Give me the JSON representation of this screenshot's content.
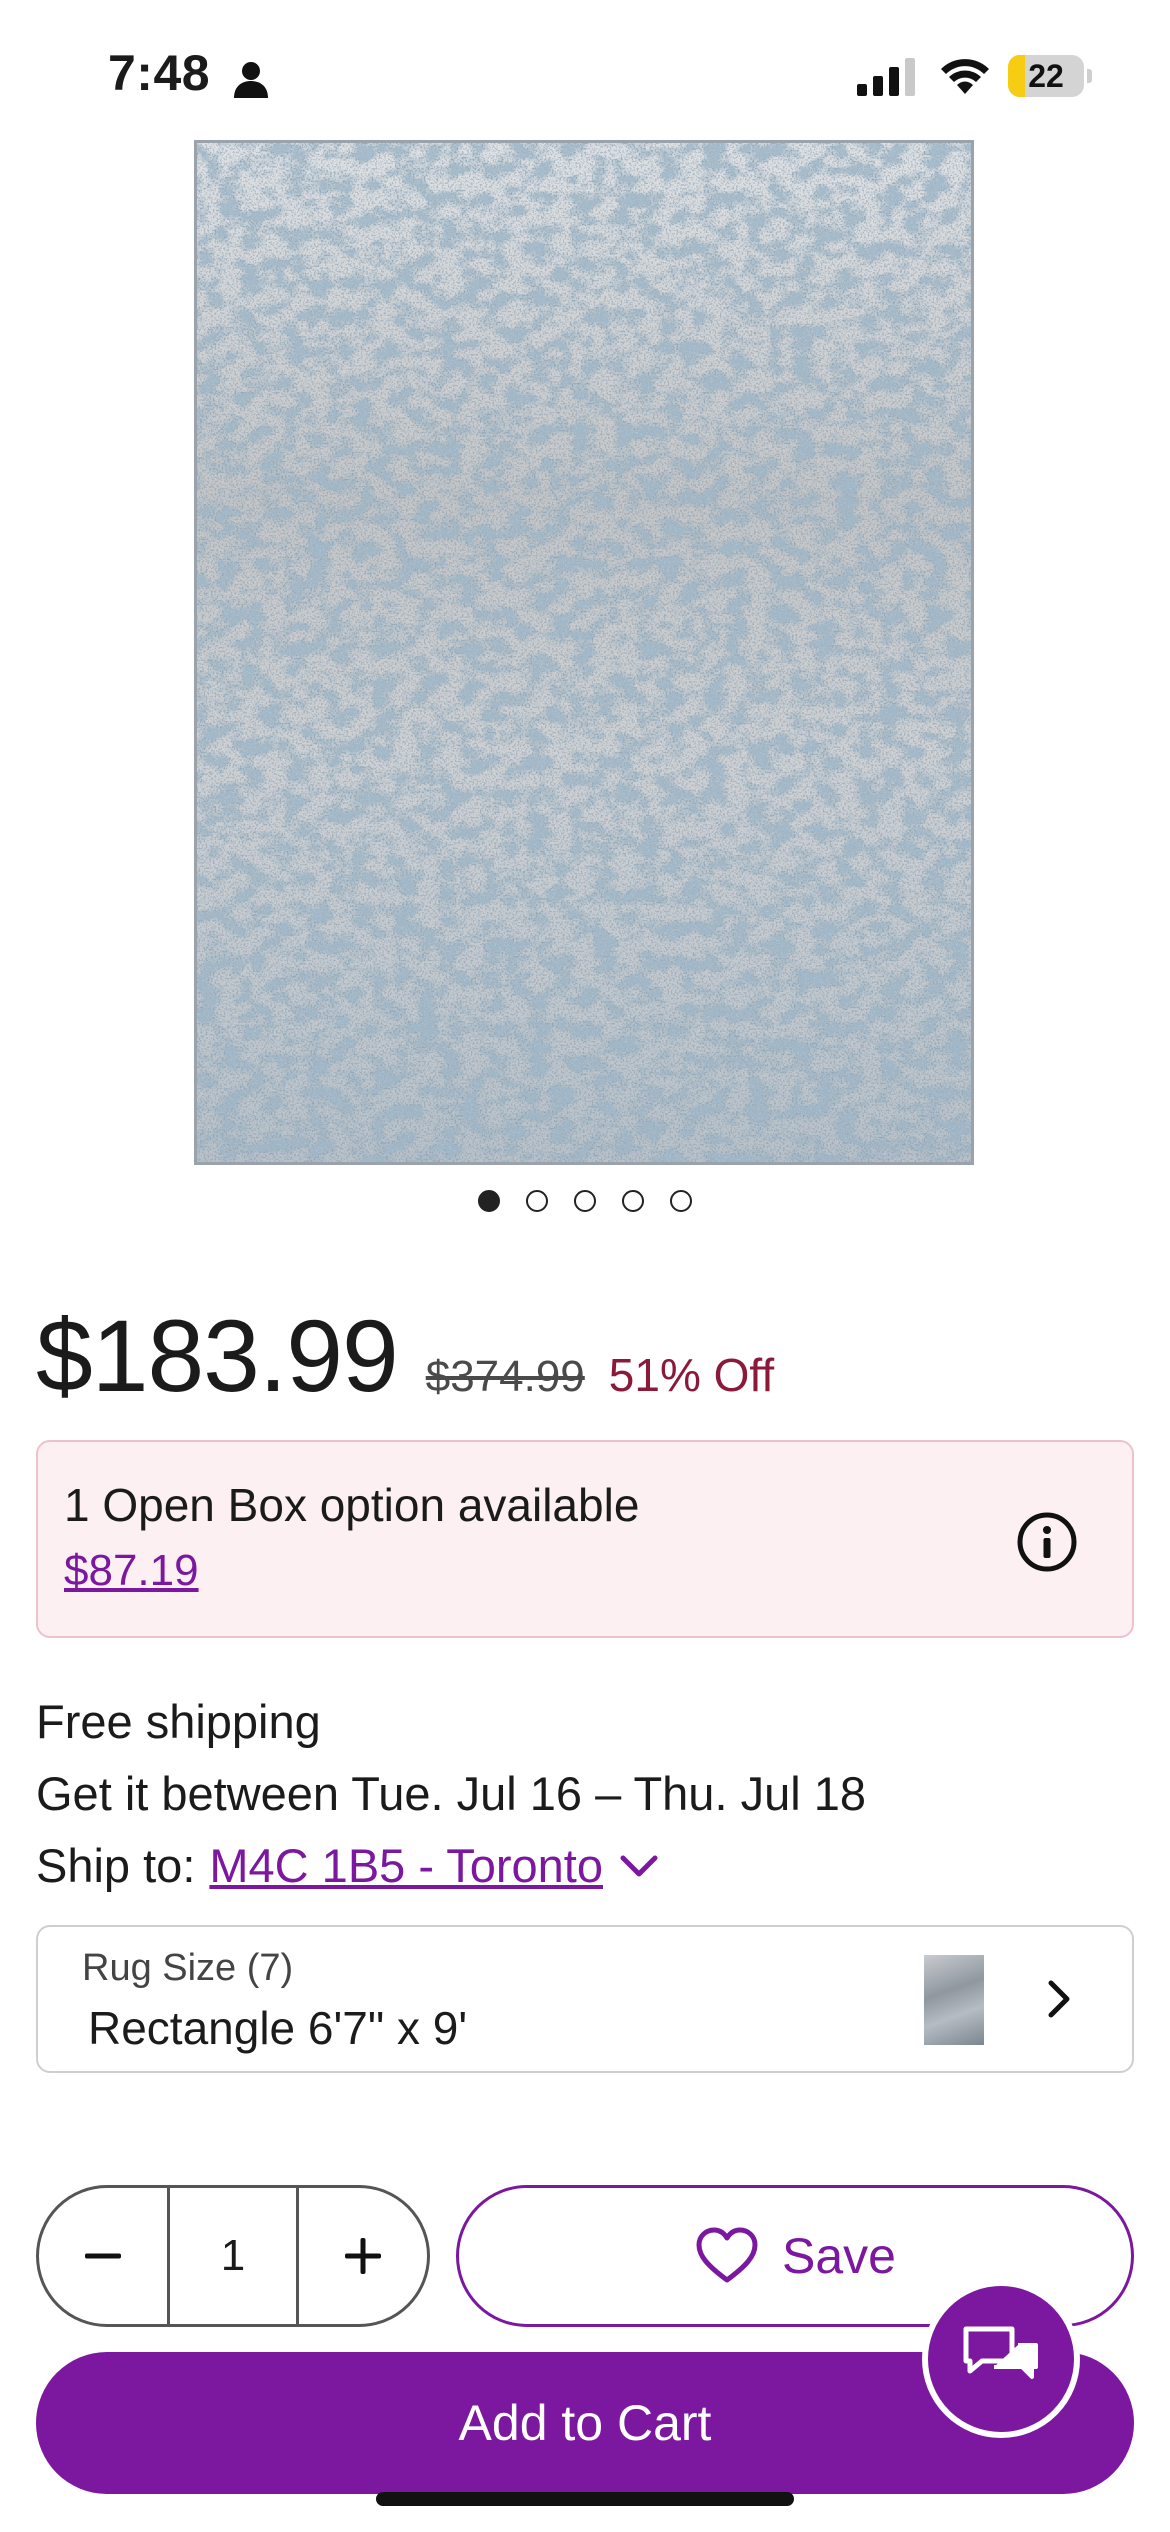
{
  "status_bar": {
    "time": "7:48",
    "battery_level": "22",
    "battery_fraction": 0.22,
    "icons": [
      "person-icon",
      "signal-icon",
      "wifi-icon",
      "battery-icon"
    ]
  },
  "product": {
    "image_alt": "Blue grey abstract area rug",
    "carousel": {
      "count": 5,
      "active_index": 0
    }
  },
  "price": {
    "current": "$183.99",
    "original": "$374.99",
    "discount": "51% Off"
  },
  "open_box": {
    "title": "1 Open Box option available",
    "price": "$87.19",
    "icon": "info-icon"
  },
  "shipping": {
    "free": "Free shipping",
    "dates": "Get it between Tue. Jul 16 – Thu. Jul 18",
    "ship_to_label": "Ship to:",
    "location": "M4C 1B5 - Toronto"
  },
  "size_selector": {
    "label": "Rug Size (7)",
    "value": "Rectangle 6'7\" x 9'"
  },
  "quantity": {
    "value": "1"
  },
  "actions": {
    "save_label": "Save",
    "add_to_cart_label": "Add to Cart"
  },
  "colors": {
    "brand_purple": "#7b189f",
    "discount_red": "#8b1a3a",
    "openbox_bg": "#fcf0f3"
  }
}
